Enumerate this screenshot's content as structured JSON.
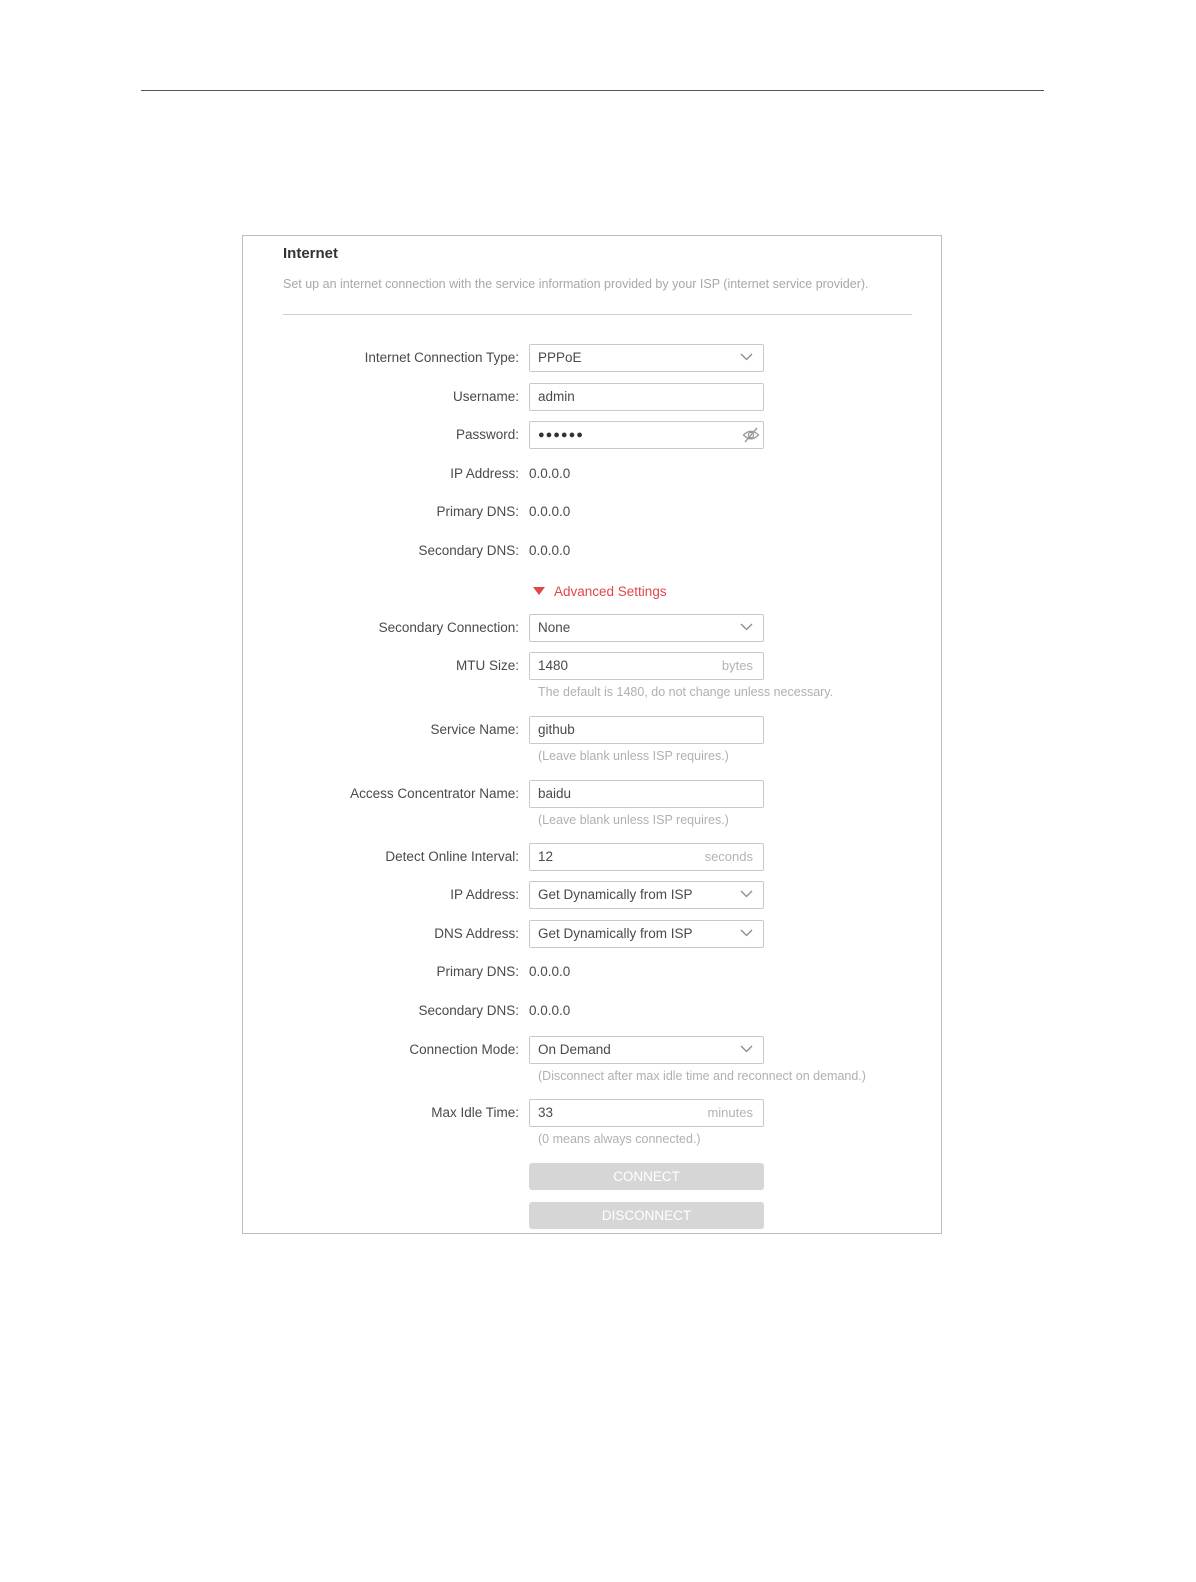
{
  "header": {
    "title": "Internet",
    "description": "Set up an internet connection with the service information provided by your ISP (internet service provider)."
  },
  "form": {
    "connection_type": {
      "label": "Internet Connection Type:",
      "value": "PPPoE"
    },
    "username": {
      "label": "Username:",
      "value": "admin"
    },
    "password": {
      "label": "Password:",
      "value": "●●●●●●"
    },
    "ip_address": {
      "label": "IP Address:",
      "value": "0.0.0.0"
    },
    "primary_dns": {
      "label": "Primary DNS:",
      "value": "0.0.0.0"
    },
    "secondary_dns": {
      "label": "Secondary DNS:",
      "value": "0.0.0.0"
    }
  },
  "advanced": {
    "toggle_label": "Advanced Settings",
    "secondary_connection": {
      "label": "Secondary Connection:",
      "value": "None"
    },
    "mtu_size": {
      "label": "MTU Size:",
      "value": "1480",
      "unit": "bytes",
      "hint": "The default is 1480, do not change unless necessary."
    },
    "service_name": {
      "label": "Service Name:",
      "value": "github",
      "hint": "(Leave blank unless ISP requires.)"
    },
    "access_concentrator": {
      "label": "Access Concentrator Name:",
      "value": "baidu",
      "hint": "(Leave blank unless ISP requires.)"
    },
    "detect_interval": {
      "label": "Detect Online Interval:",
      "value": "12",
      "unit": "seconds"
    },
    "ip_address": {
      "label": "IP Address:",
      "value": "Get Dynamically from ISP"
    },
    "dns_address": {
      "label": "DNS Address:",
      "value": "Get Dynamically from ISP"
    },
    "primary_dns": {
      "label": "Primary DNS:",
      "value": "0.0.0.0"
    },
    "secondary_dns": {
      "label": "Secondary DNS:",
      "value": "0.0.0.0"
    },
    "connection_mode": {
      "label": "Connection Mode:",
      "value": "On Demand",
      "hint": "(Disconnect after max idle time and reconnect on demand.)"
    },
    "max_idle_time": {
      "label": "Max Idle Time:",
      "value": "33",
      "unit": "minutes",
      "hint": "(0 means always connected.)"
    }
  },
  "buttons": {
    "connect": "CONNECT",
    "disconnect": "DISCONNECT"
  },
  "colors": {
    "accent": "#e0464b",
    "button_disabled": "#d6d6d6",
    "hint_text": "#b0b0b0"
  },
  "icons": {
    "dropdown": "chevron-down-icon",
    "password_visibility": "eye-off-icon",
    "advanced_toggle": "caret-down-icon"
  }
}
